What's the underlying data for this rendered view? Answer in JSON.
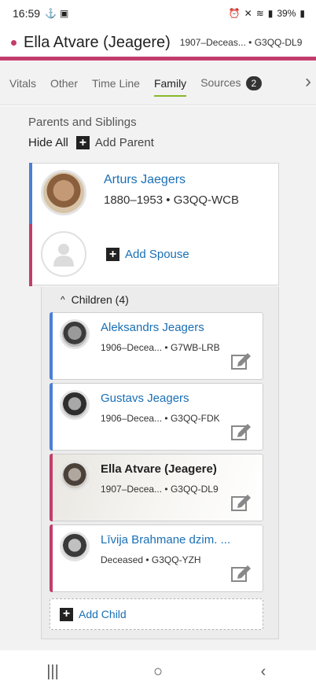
{
  "status_bar": {
    "time": "16:59",
    "battery": "39%"
  },
  "header": {
    "person_name": "Ella Atvare (Jeagere)",
    "sub": "1907–Deceas... • G3QQ-DL9"
  },
  "tabs": [
    {
      "label": "Vitals"
    },
    {
      "label": "Other"
    },
    {
      "label": "Time Line"
    },
    {
      "label": "Family"
    },
    {
      "label": "Sources",
      "badge": "2"
    }
  ],
  "section": {
    "title": "Parents and Siblings",
    "hide_all": "Hide All",
    "add_parent": "Add Parent"
  },
  "parent": {
    "name": "Arturs Jaegers",
    "dates": "1880–1953",
    "pid": "G3QQ-WCB"
  },
  "add_spouse": "Add Spouse",
  "children": {
    "header": "Children (4)",
    "items": [
      {
        "name": "Aleksandrs Jeagers",
        "dates": "1906–Decea...",
        "pid": "G7WB-LRB"
      },
      {
        "name": "Gustavs Jeagers",
        "dates": "1906–Decea...",
        "pid": "G3QQ-FDK"
      },
      {
        "name": "Ella Atvare (Jeagere)",
        "dates": "1907–Decea...",
        "pid": "G3QQ-DL9"
      },
      {
        "name": "Līvija Brahmane dzim. ...",
        "dates": "Deceased",
        "pid": "G3QQ-YZH"
      }
    ]
  },
  "add_child": "Add Child",
  "colors": {
    "accent_pink": "#c23d6c",
    "male_blue": "#4a7fd6",
    "link_blue": "#1a6fb5",
    "tab_underline": "#8ab82d"
  }
}
